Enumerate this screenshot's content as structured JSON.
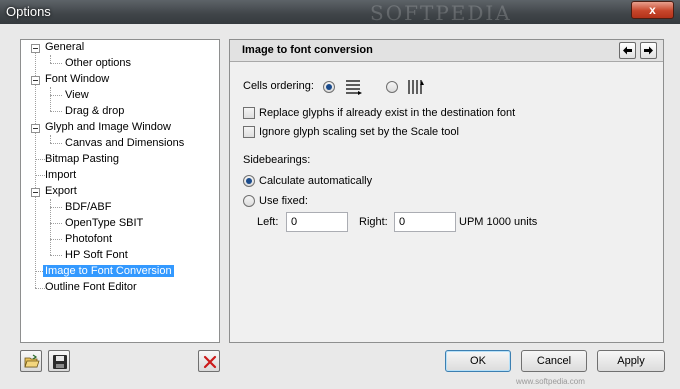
{
  "window": {
    "title": "Options",
    "brand_watermark": "SOFTPEDIA",
    "close_glyph": "x"
  },
  "tree": {
    "items": [
      {
        "label": "General"
      },
      {
        "label": "Other options"
      },
      {
        "label": "Font Window"
      },
      {
        "label": "View"
      },
      {
        "label": "Drag & drop"
      },
      {
        "label": "Glyph and Image Window"
      },
      {
        "label": "Canvas and Dimensions"
      },
      {
        "label": "Bitmap Pasting"
      },
      {
        "label": "Import"
      },
      {
        "label": "Export"
      },
      {
        "label": "BDF/ABF"
      },
      {
        "label": "OpenType SBIT"
      },
      {
        "label": "Photofont"
      },
      {
        "label": "HP Soft Font"
      },
      {
        "label": "Image to Font Conversion"
      },
      {
        "label": "Outline Font Editor"
      }
    ]
  },
  "panel": {
    "title": "Image to font conversion",
    "cells_ordering_label": "Cells ordering:",
    "cells_ordering_selected": "rows",
    "replace_glyphs_label": "Replace glyphs if already exist in the destination font",
    "replace_glyphs_checked": false,
    "ignore_scaling_label": "Ignore glyph scaling set by the Scale tool",
    "ignore_scaling_checked": false,
    "sidebearings_label": "Sidebearings:",
    "calc_auto_label": "Calculate automatically",
    "use_fixed_label": "Use fixed:",
    "sidebearings_selected": "calculate_automatically",
    "left_label": "Left:",
    "left_value": "0",
    "right_label": "Right:",
    "right_value": "0",
    "upm_label": "UPM 1000 units"
  },
  "buttons": {
    "ok": "OK",
    "cancel": "Cancel",
    "apply": "Apply"
  },
  "footer": {
    "watermark": "www.softpedia.com"
  },
  "colors": {
    "selection": "#3399ff",
    "delete_icon": "#cc1a1a"
  }
}
